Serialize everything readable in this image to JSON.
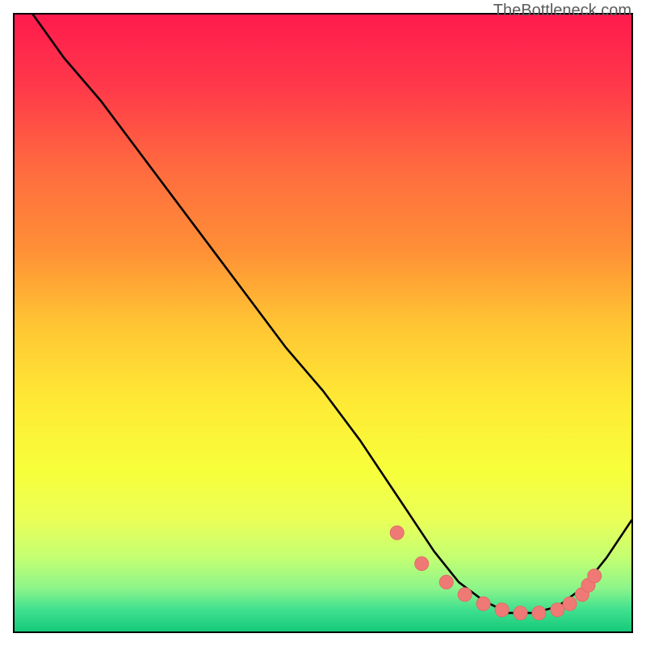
{
  "watermark": "TheBottleneck.com",
  "colors": {
    "border": "#000000",
    "curve": "#000000",
    "dot_fill": "#ef7a75",
    "dot_stroke": "#e46b66",
    "grad_stops": [
      {
        "offset": 0.0,
        "color": "#ff1a4d"
      },
      {
        "offset": 0.12,
        "color": "#ff3a4a"
      },
      {
        "offset": 0.25,
        "color": "#ff6b3f"
      },
      {
        "offset": 0.38,
        "color": "#ff8f36"
      },
      {
        "offset": 0.5,
        "color": "#ffc433"
      },
      {
        "offset": 0.62,
        "color": "#ffe835"
      },
      {
        "offset": 0.74,
        "color": "#f7ff3a"
      },
      {
        "offset": 0.82,
        "color": "#e9ff58"
      },
      {
        "offset": 0.88,
        "color": "#c4ff72"
      },
      {
        "offset": 0.93,
        "color": "#8cf58a"
      },
      {
        "offset": 0.965,
        "color": "#3fe08f"
      },
      {
        "offset": 1.0,
        "color": "#16c97a"
      }
    ]
  },
  "chart_data": {
    "type": "line",
    "title": "",
    "xlabel": "",
    "ylabel": "",
    "xlim": [
      0,
      100
    ],
    "ylim": [
      0,
      100
    ],
    "x": [
      3,
      8,
      14,
      20,
      26,
      32,
      38,
      44,
      50,
      56,
      60,
      64,
      68,
      72,
      76,
      80,
      84,
      88,
      92,
      96,
      100
    ],
    "values": [
      100,
      93,
      86,
      78,
      70,
      62,
      54,
      46,
      39,
      31,
      25,
      19,
      13,
      8,
      5,
      3,
      3,
      4,
      7,
      12,
      18
    ],
    "dot_x": [
      62,
      66,
      70,
      73,
      76,
      79,
      82,
      85,
      88,
      90,
      92,
      93,
      94
    ],
    "dot_y": [
      16,
      11,
      8,
      6,
      4.5,
      3.5,
      3,
      3,
      3.5,
      4.5,
      6,
      7.5,
      9
    ],
    "note": "x and y are percentages of plot width/height; y measured from bottom up (100=top, 0=bottom). Estimated from pixel positions; no axis ticks present in source."
  }
}
